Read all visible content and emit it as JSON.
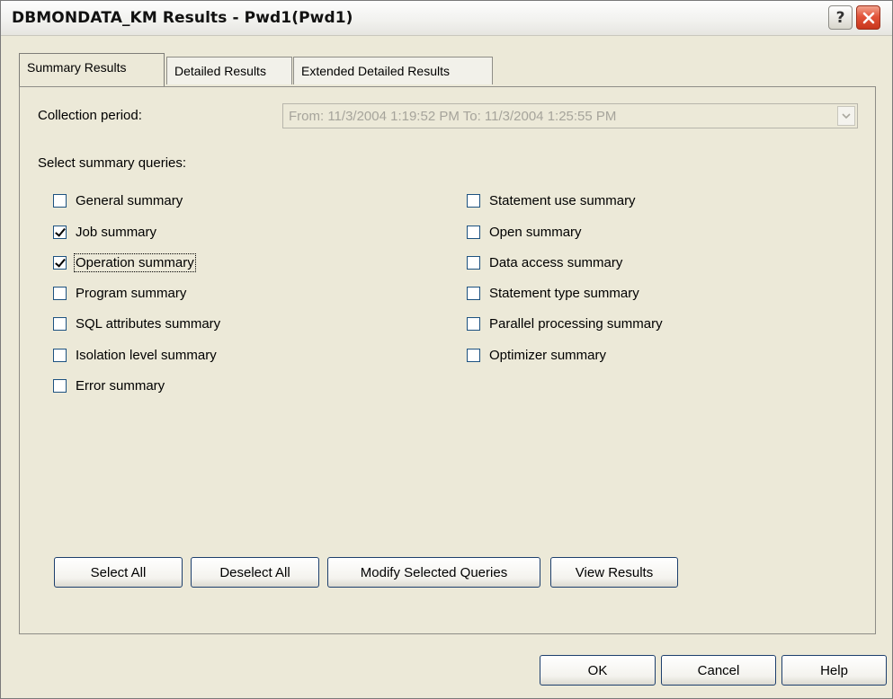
{
  "window": {
    "title": "DBMONDATA_KM Results - Pwd1(Pwd1)",
    "help_glyph": "?",
    "close_glyph": "close-icon"
  },
  "tabs": [
    {
      "label": "Summary Results",
      "active": true
    },
    {
      "label": "Detailed Results",
      "active": false
    },
    {
      "label": "Extended Detailed Results",
      "active": false
    }
  ],
  "collection_period": {
    "label": "Collection period:",
    "value": "From:  11/3/2004  1:19:52 PM   To:  11/3/2004  1:25:55 PM",
    "enabled": false
  },
  "queries": {
    "label": "Select summary queries:",
    "left": [
      {
        "label": "General summary",
        "checked": false
      },
      {
        "label": "Job summary",
        "checked": true
      },
      {
        "label": "Operation summary",
        "checked": true,
        "focused": true
      },
      {
        "label": "Program summary",
        "checked": false
      },
      {
        "label": "SQL attributes summary",
        "checked": false
      },
      {
        "label": "Isolation level summary",
        "checked": false
      },
      {
        "label": "Error summary",
        "checked": false
      }
    ],
    "right": [
      {
        "label": "Statement use summary",
        "checked": false
      },
      {
        "label": "Open summary",
        "checked": false
      },
      {
        "label": "Data access summary",
        "checked": false
      },
      {
        "label": "Statement type summary",
        "checked": false
      },
      {
        "label": "Parallel processing summary",
        "checked": false
      },
      {
        "label": "Optimizer summary",
        "checked": false
      }
    ]
  },
  "actions": {
    "select_all": "Select All",
    "deselect_all": "Deselect All",
    "modify_selected": "Modify Selected Queries",
    "view_results": "View Results"
  },
  "footer": {
    "ok": "OK",
    "cancel": "Cancel",
    "help": "Help"
  },
  "colors": {
    "dialog_bg": "#ece9d8",
    "close_red": "#e2543a",
    "button_border": "#1d3f6d",
    "disabled_text": "#a6a49b"
  }
}
